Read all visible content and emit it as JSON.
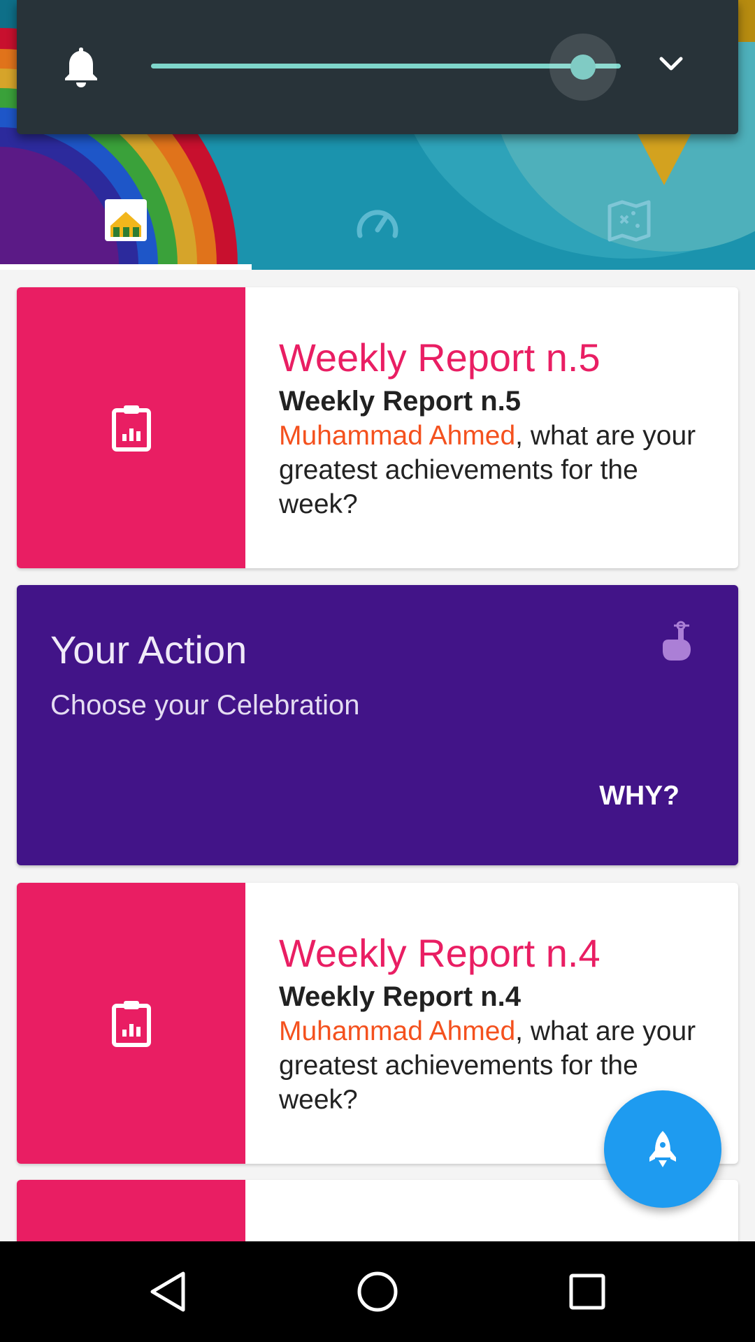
{
  "header": {
    "tabs": [
      {
        "icon": "home-icon",
        "selected": true
      },
      {
        "icon": "speedometer-icon",
        "selected": false
      },
      {
        "icon": "map-icon",
        "selected": false
      }
    ],
    "colors": {
      "background": "#1b93ad",
      "underline": "#ffffff"
    }
  },
  "volume": {
    "icon": "bell-icon",
    "level": 0.92,
    "expand_icon": "chevron-down-icon",
    "colors": {
      "panel": "#283339",
      "track": "#7fd6cb",
      "thumb": "#80cbc4"
    }
  },
  "cards": [
    {
      "icon": "clipboard-chart-icon",
      "big_title": "Weekly Report n.5",
      "sub_title": "Weekly Report n.5",
      "name": "Muhammad Ahmed",
      "body": ", what are your greatest achievements for the week?"
    },
    {
      "icon": "clipboard-chart-icon",
      "big_title": "Weekly Report n.4",
      "sub_title": "Weekly Report n.4",
      "name": "Muhammad Ahmed",
      "body": ", what are your greatest achievements for the week?"
    }
  ],
  "action_card": {
    "title": "Your Action",
    "subtitle": "Choose your Celebration",
    "button": "WHY?",
    "icon": "finger-ribbon-icon",
    "color": "#421488"
  },
  "fab": {
    "icon": "rocket-icon",
    "color": "#1e9bf0"
  },
  "navbar": {
    "buttons": [
      "back-icon",
      "home-circle-icon",
      "recents-icon"
    ]
  },
  "accent_colors": {
    "report": "#e91e63",
    "name": "#f4511e"
  }
}
